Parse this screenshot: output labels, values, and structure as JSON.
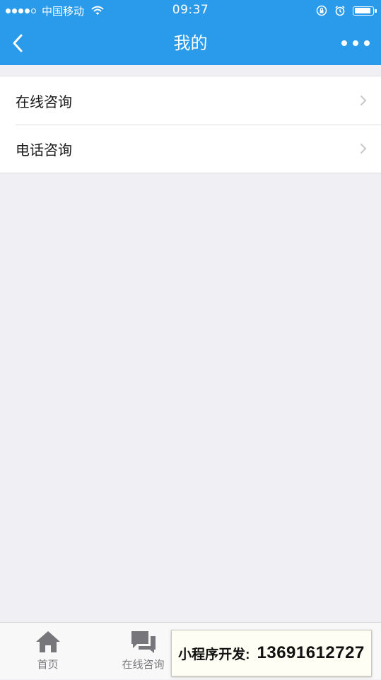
{
  "status_bar": {
    "signal_icon": "signal-dots-icon",
    "carrier": "中国移动",
    "time": "09:37",
    "icons": [
      "wifi-icon",
      "orientation-lock-icon",
      "alarm-icon",
      "battery-icon"
    ]
  },
  "nav": {
    "title": "我的",
    "back_icon": "chevron-left-icon",
    "more_icon": "more-dots-icon",
    "color": "#2a9bea"
  },
  "menu": {
    "items": [
      {
        "label": "在线咨询",
        "icon": "chevron-right-icon"
      },
      {
        "label": "电话咨询",
        "icon": "chevron-right-icon"
      }
    ]
  },
  "tab_bar": {
    "tabs": [
      {
        "label": "首页",
        "icon": "home-icon"
      },
      {
        "label": "在线咨询",
        "icon": "chat-bubbles-icon"
      }
    ]
  },
  "promo": {
    "label": "小程序开发:",
    "phone": "13691612727"
  }
}
